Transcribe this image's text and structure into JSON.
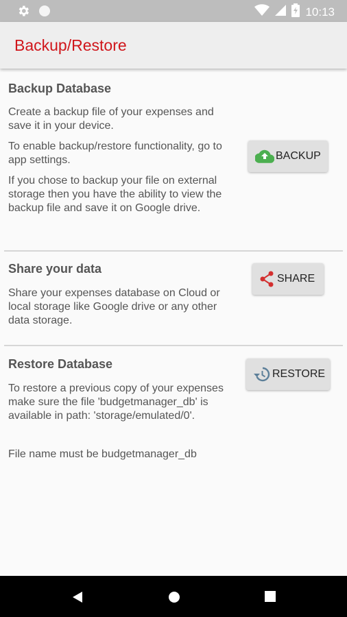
{
  "status_bar": {
    "time": "10:13",
    "icons": [
      "gear-icon",
      "circle-icon",
      "wifi-icon",
      "signal-icon",
      "battery-icon"
    ]
  },
  "app_bar": {
    "title": "Backup/Restore"
  },
  "backup_section": {
    "title": "Backup Database",
    "para1": "Create a backup file of your expenses and save it in your device.",
    "para2": "To enable backup/restore functionality, go to app settings.",
    "para3": "If you chose to backup your file on external storage then you have the ability to view the backup file and save it on Google drive.",
    "button_label": "BACKUP",
    "button_icon": "cloud-upload-icon"
  },
  "share_section": {
    "title": "Share your data",
    "para1": "Share your expenses database on Cloud or local storage like Google drive or any other data storage.",
    "button_label": "SHARE",
    "button_icon": "share-icon"
  },
  "restore_section": {
    "title": "Restore Database",
    "para1": "To restore a previous copy of your expenses make sure the file 'budgetmanager_db' is available in path: 'storage/emulated/0'.",
    "para2": "File name must be budgetmanager_db",
    "button_label": "RESTORE",
    "button_icon": "restore-history-icon"
  },
  "colors": {
    "accent": "#d0161b",
    "cloud_green": "#4caf50",
    "share_red": "#d32f2f",
    "restore_blue": "#5c7f99"
  },
  "nav_bar": {
    "icons": [
      "back-icon",
      "home-icon",
      "recents-icon"
    ]
  }
}
